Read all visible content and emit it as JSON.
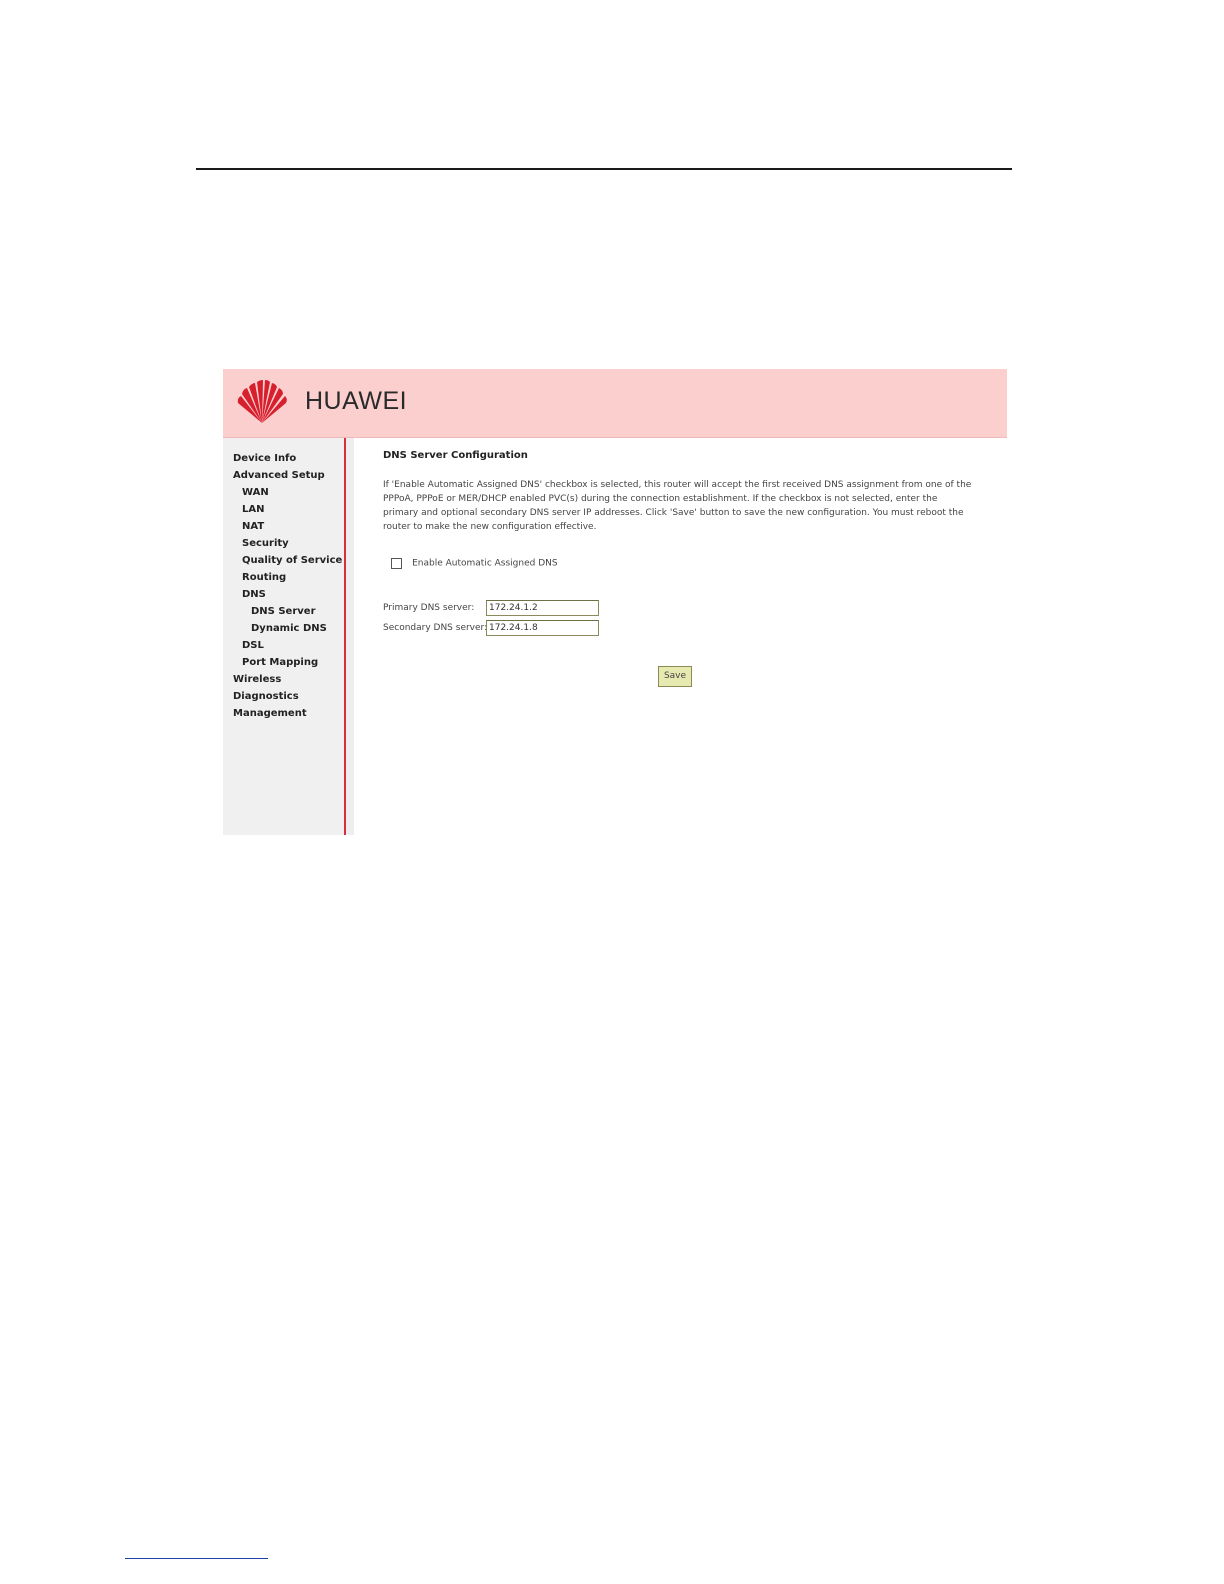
{
  "brand": {
    "name": "HUAWEI"
  },
  "sidebar": {
    "items": [
      {
        "label": "Device Info"
      },
      {
        "label": "Advanced Setup"
      },
      {
        "label": "WAN"
      },
      {
        "label": "LAN"
      },
      {
        "label": "NAT"
      },
      {
        "label": "Security"
      },
      {
        "label": "Quality of Service"
      },
      {
        "label": "Routing"
      },
      {
        "label": "DNS"
      },
      {
        "label": "DNS Server"
      },
      {
        "label": "Dynamic DNS"
      },
      {
        "label": "DSL"
      },
      {
        "label": "Port Mapping"
      },
      {
        "label": "Wireless"
      },
      {
        "label": "Diagnostics"
      },
      {
        "label": "Management"
      }
    ]
  },
  "main": {
    "title": "DNS Server Configuration",
    "description": "If 'Enable Automatic Assigned DNS' checkbox is selected, this router will accept the first received DNS assignment from one of the PPPoA, PPPoE or MER/DHCP enabled PVC(s) during the connection establishment. If the checkbox is not selected, enter the primary and optional secondary DNS server IP addresses. Click 'Save' button to save the new configuration. You must reboot the router to make the new configuration effective.",
    "auto_dns": {
      "label": "Enable Automatic Assigned DNS",
      "checked": false
    },
    "primary_dns": {
      "label": "Primary DNS server:",
      "value": "172.24.1.2"
    },
    "secondary_dns": {
      "label": "Secondary DNS server:",
      "value": "172.24.1.8"
    },
    "save_label": "Save"
  },
  "colors": {
    "banner": "#fccfcf",
    "sidebar_divider": "#d7303a",
    "logo": "#d7202e",
    "save_button": "#e6eab0"
  }
}
